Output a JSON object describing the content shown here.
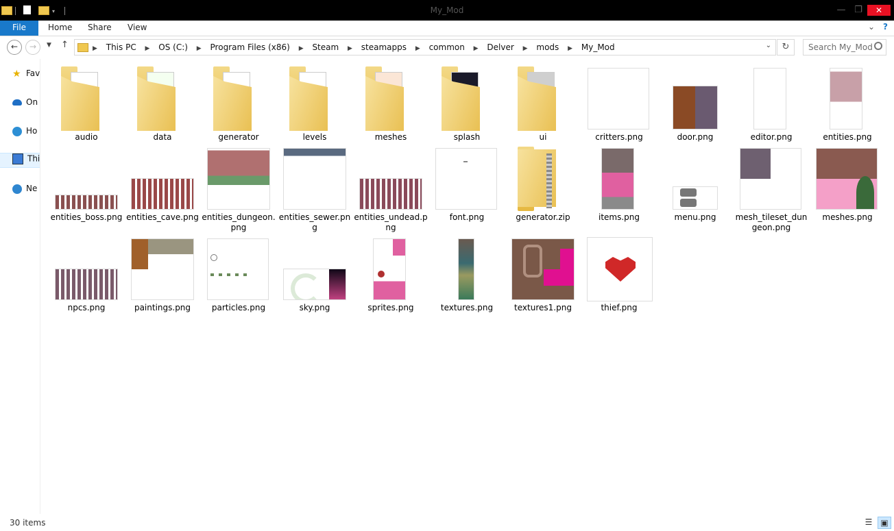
{
  "window": {
    "title": "My_Mod",
    "minimize": "—",
    "maximize": "❐",
    "close": "✕"
  },
  "ribbon": {
    "file": "File",
    "tabs": [
      "Home",
      "Share",
      "View"
    ]
  },
  "address": {
    "crumbs": [
      "This PC",
      "OS (C:)",
      "Program Files (x86)",
      "Steam",
      "steamapps",
      "common",
      "Delver",
      "mods",
      "My_Mod"
    ],
    "search_placeholder": "Search My_Mod"
  },
  "nav_pane": {
    "items": [
      "Fav",
      "On",
      "Ho",
      "Thi",
      "Ne"
    ]
  },
  "items": [
    {
      "name": "audio",
      "kind": "folder"
    },
    {
      "name": "data",
      "kind": "folder"
    },
    {
      "name": "generator",
      "kind": "folder"
    },
    {
      "name": "levels",
      "kind": "folder"
    },
    {
      "name": "meshes",
      "kind": "folder"
    },
    {
      "name": "splash",
      "kind": "folder"
    },
    {
      "name": "ui",
      "kind": "folder"
    },
    {
      "name": "critters.png",
      "kind": "png"
    },
    {
      "name": "door.png",
      "kind": "png"
    },
    {
      "name": "editor.png",
      "kind": "png"
    },
    {
      "name": "entities.png",
      "kind": "png"
    },
    {
      "name": "entities_boss.png",
      "kind": "png"
    },
    {
      "name": "entities_cave.png",
      "kind": "png"
    },
    {
      "name": "entities_dungeon.png",
      "kind": "png"
    },
    {
      "name": "entities_sewer.png",
      "kind": "png"
    },
    {
      "name": "entities_undead.png",
      "kind": "png"
    },
    {
      "name": "font.png",
      "kind": "png"
    },
    {
      "name": "generator.zip",
      "kind": "zip"
    },
    {
      "name": "items.png",
      "kind": "png"
    },
    {
      "name": "menu.png",
      "kind": "png"
    },
    {
      "name": "mesh_tileset_dungeon.png",
      "kind": "png"
    },
    {
      "name": "meshes.png",
      "kind": "png"
    },
    {
      "name": "npcs.png",
      "kind": "png"
    },
    {
      "name": "paintings.png",
      "kind": "png"
    },
    {
      "name": "particles.png",
      "kind": "png"
    },
    {
      "name": "sky.png",
      "kind": "png"
    },
    {
      "name": "sprites.png",
      "kind": "png"
    },
    {
      "name": "textures.png",
      "kind": "png"
    },
    {
      "name": "textures1.png",
      "kind": "png"
    },
    {
      "name": "thief.png",
      "kind": "png"
    }
  ],
  "status": {
    "count": "30 items"
  },
  "colors": {
    "file_tab": "#1979ca",
    "close": "#e81123",
    "folder": "#f0c850",
    "selection": "#e5f3ff"
  },
  "icons": {
    "view_details": "details-view-icon",
    "view_large": "large-icons-view-icon"
  }
}
